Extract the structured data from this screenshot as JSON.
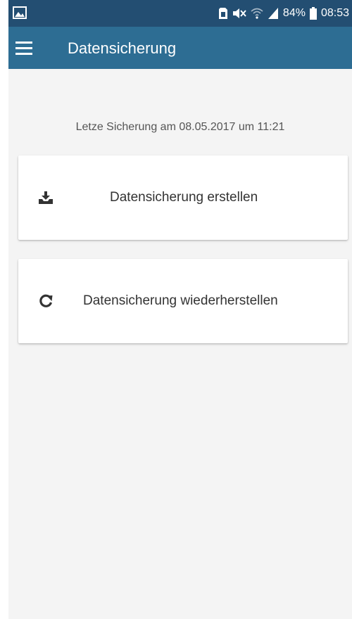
{
  "status_bar": {
    "battery": "84%",
    "time": "08:53",
    "icons": [
      "image-icon",
      "sim-icon",
      "mute-icon",
      "wifi-icon",
      "signal-icon",
      "battery-icon"
    ]
  },
  "app_bar": {
    "title": "Datensicherung",
    "menu_icon": "hamburger-menu-icon"
  },
  "content": {
    "last_backup_text": "Letze Sicherung am 08.05.2017 um 11:21",
    "actions": [
      {
        "label": "Datensicherung erstellen",
        "icon": "download-tray-icon"
      },
      {
        "label": "Datensicherung wiederherstellen",
        "icon": "refresh-icon"
      }
    ]
  },
  "colors": {
    "status_bar": "#234e72",
    "app_bar": "#2d6d93",
    "background": "#f4f4f4",
    "card": "#ffffff",
    "text_primary": "#333333",
    "text_secondary": "#555555"
  }
}
